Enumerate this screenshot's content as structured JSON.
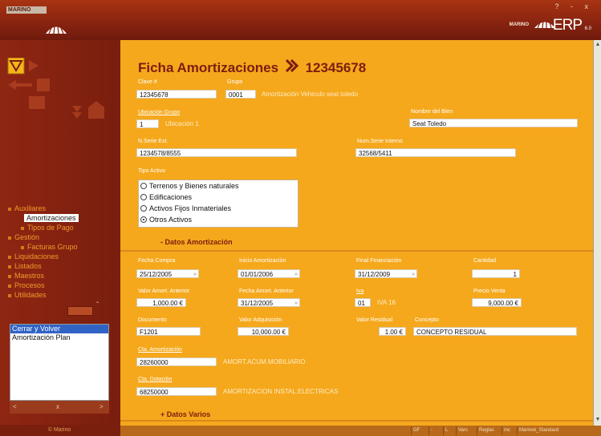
{
  "app": {
    "brand": "MARINO",
    "logo_small": "MARINO",
    "logo_product": "ERP",
    "logo_version": "6.0",
    "window_controls": "? - x"
  },
  "nav": {
    "items": [
      {
        "label": "Auxiliares"
      },
      {
        "label": "Amortizaciones"
      },
      {
        "label": "Tipos de Pago"
      },
      {
        "label": "Gestión"
      },
      {
        "label": "Facturas Grupo"
      },
      {
        "label": "Liquidaciones"
      },
      {
        "label": "Listados"
      },
      {
        "label": "Maestros"
      },
      {
        "label": "Procesos"
      },
      {
        "label": "Utilidades"
      }
    ],
    "actions": [
      {
        "label": "Cerrar y Volver"
      },
      {
        "label": "Amortización Plan"
      }
    ],
    "dash": "-",
    "box_nav": {
      "prev": "<",
      "mid": "x",
      "next": ">"
    },
    "footer": "© Marino"
  },
  "form": {
    "title": "Ficha Amortizaciones",
    "record_id": "12345678",
    "clave_label": "Clave #",
    "clave_value": "12345678",
    "grupo_label": "Grupo",
    "grupo_value": "0001",
    "grupo_desc": "Amortización Vehiculo seat toledo",
    "ubicacion_label": "Ubicación Grupo",
    "ubicacion_value": "1",
    "ubicacion_desc": "Ubicación 1",
    "nombre_label": "Nombre del Bien",
    "nombre_value": "Seat Toledo",
    "nserie_ext_label": "N.Serie Ext.",
    "nserie_ext_value": "1234578/8555",
    "nserie_int_label": "Num.Serie Interno",
    "nserie_int_value": "32568/5411",
    "tipo_label": "Tipo Activo",
    "tipo_options": [
      {
        "label": "Terrenos y Bienes naturales"
      },
      {
        "label": "Edificaciones"
      },
      {
        "label": "Activos Fijos Inmateriales"
      },
      {
        "label": "Otros Activos"
      }
    ],
    "tipo_selected_index": 3,
    "section_amort": "- Datos Amortización",
    "fecha_compra_label": "Fecha Compra",
    "fecha_compra_value": "25/12/2005",
    "inicio_amort_label": "Inicio Amortización",
    "inicio_amort_value": "01/01/2006",
    "final_fin_label": "Final Financiación",
    "final_fin_value": "31/12/2009",
    "cantidad_label": "Cantidad",
    "cantidad_value": "1",
    "valor_anterior_label": "Valor Amort. Anterior",
    "valor_anterior_value": "1,000.00 €",
    "fecha_anterior_label": "Fecha Amort. Anterior",
    "fecha_anterior_value": "31/12/2005",
    "iva_label": "Iva",
    "iva_value": "01",
    "iva_desc": "IVA 16",
    "precio_venta_label": "Precio Venta",
    "precio_venta_value": "9,000.00 €",
    "documento_label": "Documento",
    "documento_value": "F1201",
    "valor_adq_label": "Valor Adquisición",
    "valor_adq_value": "10,000.00 €",
    "valor_residual_label": "Valor Residual",
    "valor_residual_value": "1.00 €",
    "concepto_label": "Concepto",
    "concepto_value": "CONCEPTO RESIDUAL",
    "cta_amort_label": "Cta. Amortización",
    "cta_amort_value": "28260000",
    "cta_amort_desc": "AMORT.ACUM.MOBILIARIO",
    "cta_dot_label": "Cta. Dotación",
    "cta_dot_value": "68250000",
    "cta_dot_desc": "AMORTIZACION INSTAL.ELECTRICAS",
    "section_varios": "+ Datos Varios",
    "dropdown_glyph": "»"
  },
  "status": {
    "cells": [
      "GF",
      "-",
      "L",
      "Vars",
      "Reglas",
      "mc",
      "Marinok_Standard"
    ]
  },
  "colors": {
    "form_bg": "#f5a81c",
    "title": "#7b1e10",
    "panel": "#7a1e0e",
    "accent": "#f39a2a"
  }
}
